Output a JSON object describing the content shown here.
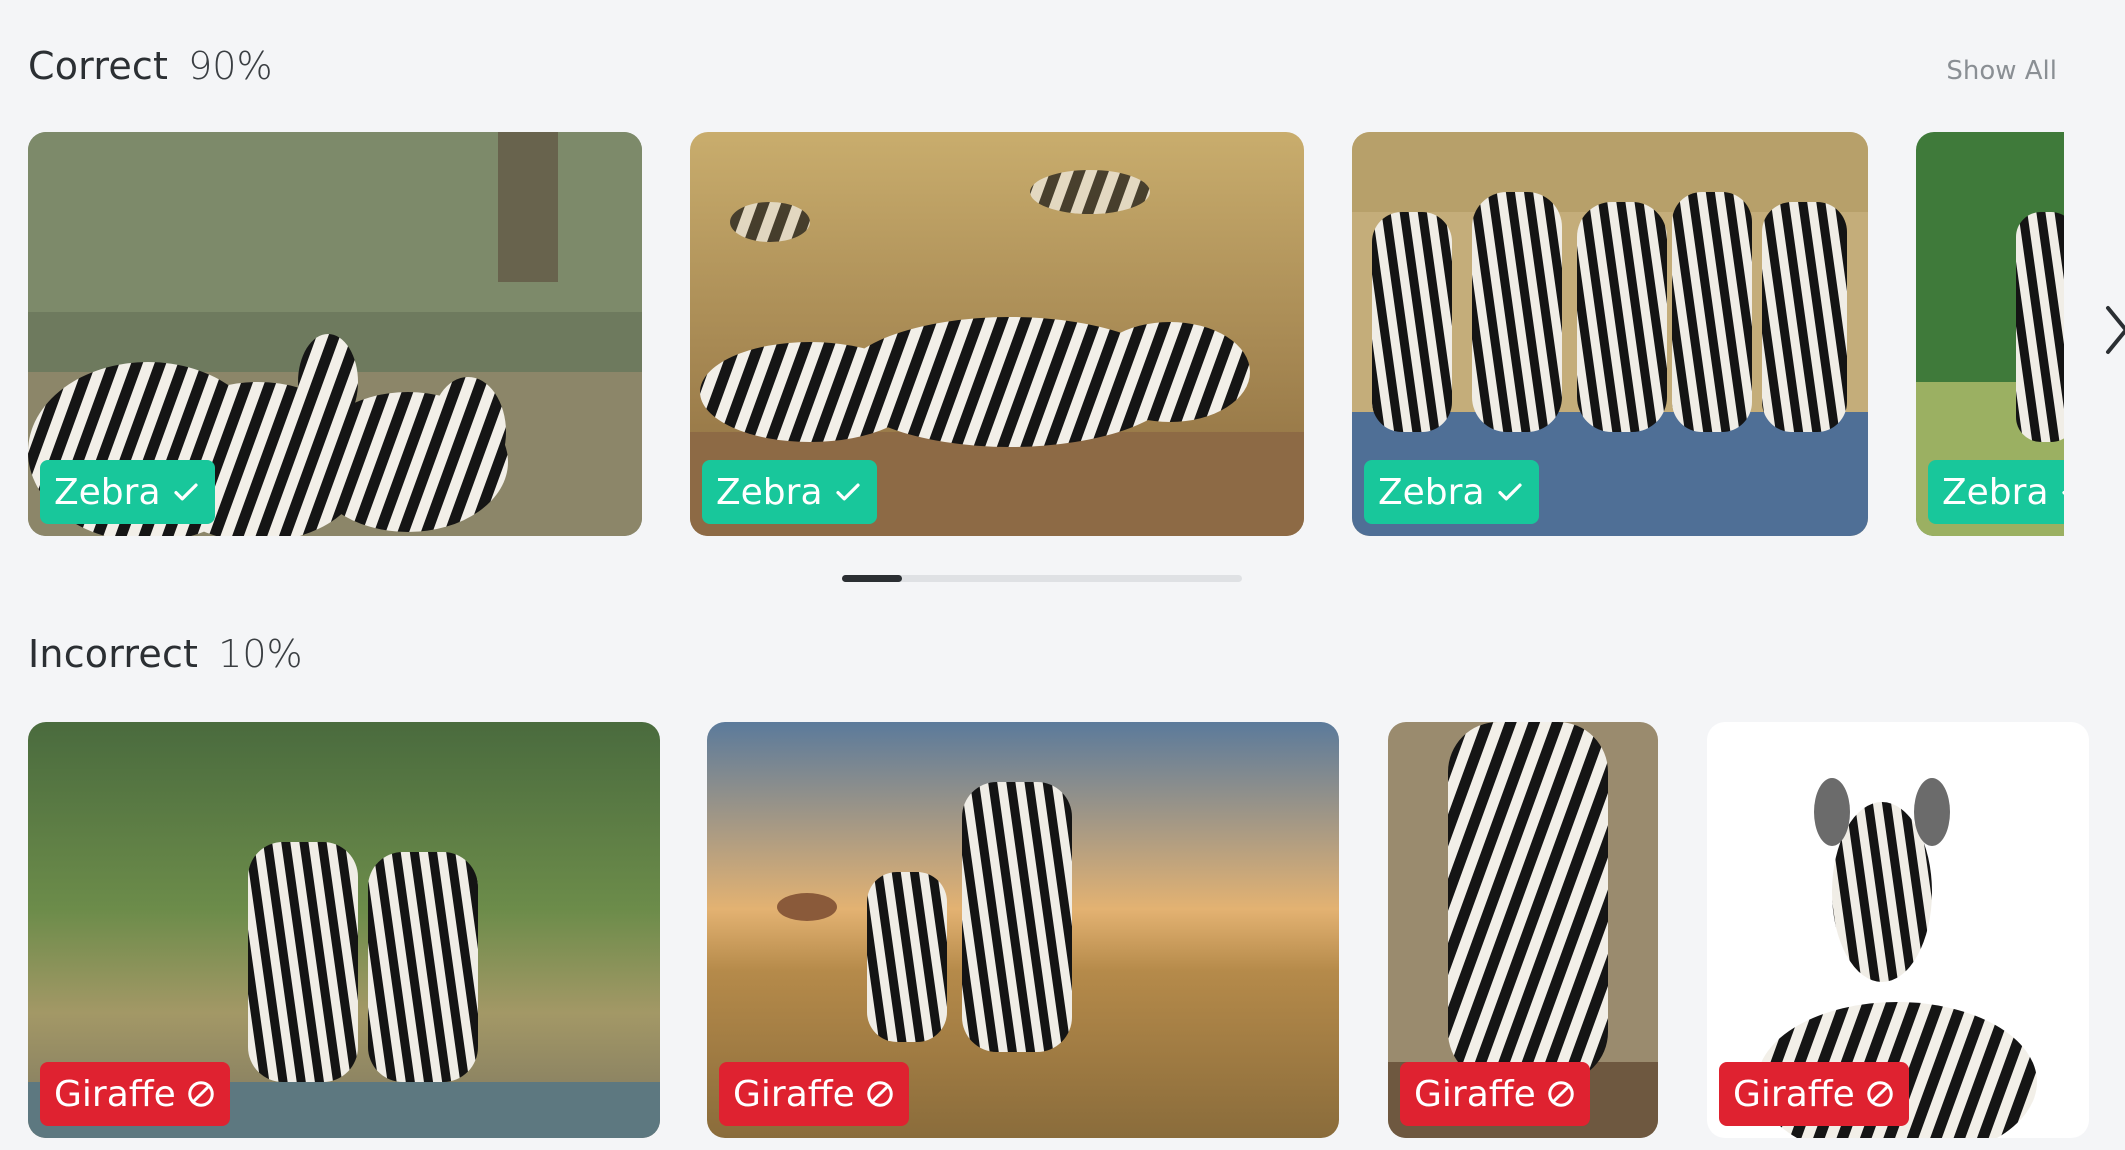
{
  "correct": {
    "title": "Correct",
    "percent": "90%",
    "show_all_label": "Show All",
    "scroll_progress": 0.15,
    "cards": [
      {
        "label": "Zebra",
        "status": "correct"
      },
      {
        "label": "Zebra",
        "status": "correct"
      },
      {
        "label": "Zebra",
        "status": "correct"
      },
      {
        "label": "Zebra",
        "status": "correct"
      }
    ],
    "next_icon": "chevron-right-icon"
  },
  "incorrect": {
    "title": "Incorrect",
    "percent": "10%",
    "cards": [
      {
        "label": "Giraffe",
        "status": "incorrect"
      },
      {
        "label": "Giraffe",
        "status": "incorrect"
      },
      {
        "label": "Giraffe",
        "status": "incorrect"
      },
      {
        "label": "Giraffe",
        "status": "incorrect"
      }
    ]
  },
  "colors": {
    "correct_badge": "#18c79b",
    "incorrect_badge": "#df2230",
    "background": "#f4f5f7"
  },
  "icons": {
    "correct": "checkmark-icon",
    "incorrect": "prohibited-icon"
  }
}
